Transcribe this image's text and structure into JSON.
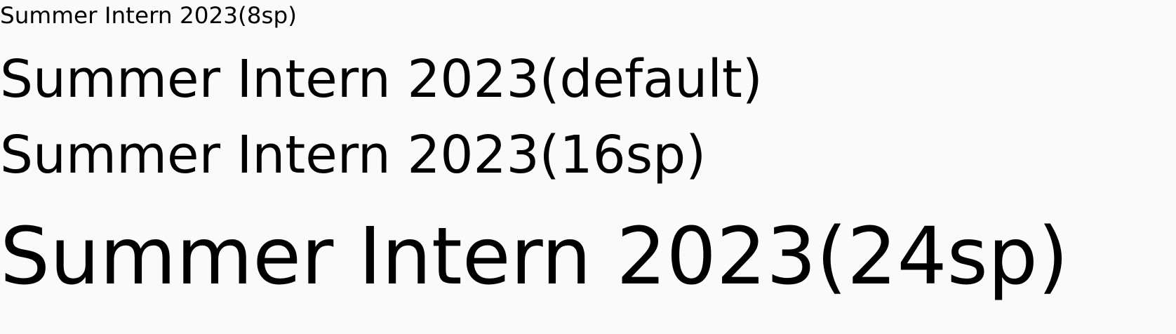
{
  "screen": {
    "background": "#fafafa",
    "text_color": "#000000",
    "lines": [
      {
        "label": "Summer Intern 2023(8sp)"
      },
      {
        "label": "Summer Intern 2023(default)"
      },
      {
        "label": "Summer Intern 2023(16sp)"
      },
      {
        "label": "Summer Intern 2023(24sp)"
      }
    ]
  }
}
